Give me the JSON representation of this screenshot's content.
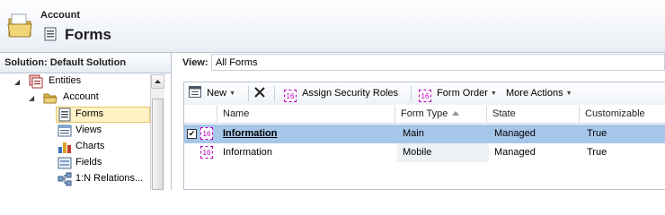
{
  "header": {
    "entity_name": "Account",
    "page_title": "Forms",
    "folder_icon": "folder-icon",
    "forms_icon": "form-icon"
  },
  "nav": {
    "header": "Solution: Default Solution",
    "items": [
      {
        "label": "Entities",
        "icon": "entities-icon",
        "level": 0,
        "expanded": true
      },
      {
        "label": "Account",
        "icon": "folder-icon",
        "level": 1,
        "expanded": true
      },
      {
        "label": "Forms",
        "icon": "form-icon",
        "level": 2,
        "selected": true
      },
      {
        "label": "Views",
        "icon": "view-icon",
        "level": 2
      },
      {
        "label": "Charts",
        "icon": "chart-icon",
        "level": 2
      },
      {
        "label": "Fields",
        "icon": "field-icon",
        "level": 2
      },
      {
        "label": "1:N Relations...",
        "icon": "relationship-icon",
        "level": 2
      }
    ]
  },
  "view": {
    "label": "View:",
    "selected": "All Forms"
  },
  "toolbar": {
    "new_label": "New",
    "assign_label": "Assign Security Roles",
    "form_order_label": "Form Order",
    "more_actions_label": "More Actions"
  },
  "placeholder_icon_text": "16",
  "columns": [
    "Name",
    "Form Type",
    "State",
    "Customizable"
  ],
  "rows": [
    {
      "name": "Information",
      "form_type": "Main",
      "state": "Managed",
      "customizable": "True",
      "selected": true
    },
    {
      "name": "Information",
      "form_type": "Mobile",
      "state": "Managed",
      "customizable": "True",
      "selected": false
    }
  ],
  "colors": {
    "selected_row": "#a6c6ea",
    "nav_selected": "#fff3c6",
    "placeholder_icon": "#c000c0"
  }
}
